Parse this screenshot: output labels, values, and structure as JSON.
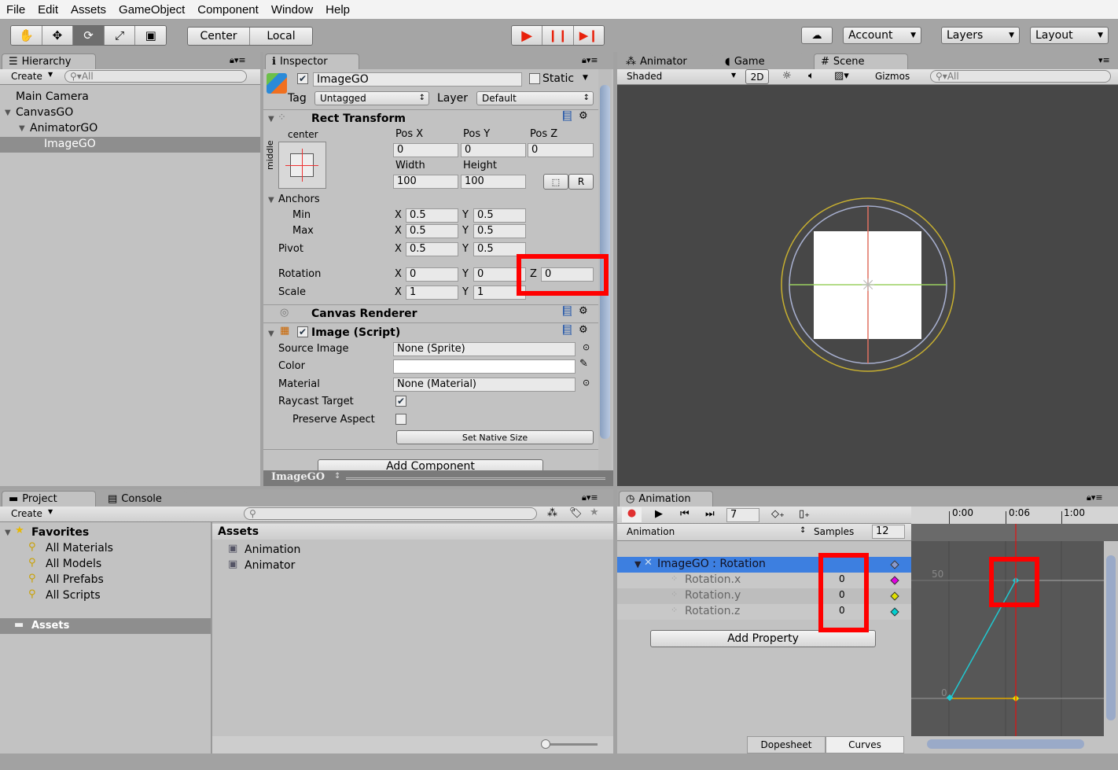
{
  "menu": [
    "File",
    "Edit",
    "Assets",
    "GameObject",
    "Component",
    "Window",
    "Help"
  ],
  "toolbar": {
    "tools": [
      "hand-icon",
      "move-icon",
      "rotate-icon",
      "scale-icon",
      "rect-icon"
    ],
    "pivot": "Center",
    "space": "Local",
    "account": "Account",
    "layers": "Layers",
    "layout": "Layout"
  },
  "hierarchy": {
    "tab": "Hierarchy",
    "create": "Create",
    "search": "All",
    "items": [
      {
        "label": "Main Camera",
        "indent": 0,
        "expanded": null,
        "selected": false
      },
      {
        "label": "CanvasGO",
        "indent": 0,
        "expanded": true,
        "selected": false
      },
      {
        "label": "AnimatorGO",
        "indent": 1,
        "expanded": true,
        "selected": false
      },
      {
        "label": "ImageGO",
        "indent": 2,
        "expanded": null,
        "selected": true
      }
    ]
  },
  "inspector": {
    "tab": "Inspector",
    "name": "ImageGO",
    "static": "Static",
    "tag_label": "Tag",
    "tag": "Untagged",
    "layer_label": "Layer",
    "layer": "Default",
    "rect": {
      "title": "Rect Transform",
      "anchor_h": "center",
      "anchor_v": "middle",
      "posx_l": "Pos X",
      "posy_l": "Pos Y",
      "posz_l": "Pos Z",
      "posx": "0",
      "posy": "0",
      "posz": "0",
      "width_l": "Width",
      "height_l": "Height",
      "width": "100",
      "height": "100",
      "r": "R",
      "anchors": "Anchors",
      "min": "Min",
      "max": "Max",
      "pivot": "Pivot",
      "minx": "0.5",
      "miny": "0.5",
      "maxx": "0.5",
      "maxy": "0.5",
      "pivx": "0.5",
      "pivy": "0.5",
      "rotation": "Rotation",
      "scale": "Scale",
      "rotx": "0",
      "roty": "0",
      "rotz": "0",
      "scx": "1",
      "scy": "1",
      "x": "X",
      "y": "Y",
      "z": "Z"
    },
    "canvas_renderer": "Canvas Renderer",
    "image": {
      "title": "Image (Script)",
      "source_l": "Source Image",
      "source": "None (Sprite)",
      "color_l": "Color",
      "material_l": "Material",
      "material": "None (Material)",
      "raycast_l": "Raycast Target",
      "raycast": true,
      "preserve_l": "Preserve Aspect",
      "preserve": false,
      "native": "Set Native Size"
    },
    "add_component": "Add Component",
    "footer": "ImageGO"
  },
  "scene": {
    "tabs": [
      "Animator",
      "Game",
      "Scene"
    ],
    "active_tab": "Scene",
    "shading": "Shaded",
    "mode2d": "2D",
    "gizmos": "Gizmos",
    "search": "All"
  },
  "project": {
    "tabs": [
      "Project",
      "Console"
    ],
    "create": "Create",
    "favorites": "Favorites",
    "fav_items": [
      "All Materials",
      "All Models",
      "All Prefabs",
      "All Scripts"
    ],
    "assets_root": "Assets",
    "assets_header": "Assets",
    "assets": [
      {
        "label": "Animation",
        "icon": "animation-clip-icon"
      },
      {
        "label": "Animator",
        "icon": "animator-controller-icon"
      }
    ]
  },
  "animation": {
    "tab": "Animation",
    "frame": "7",
    "clip": "Animation",
    "samples_l": "Samples",
    "samples": "12",
    "tracks": [
      {
        "label": "ImageGO : Rotation",
        "value": "",
        "selected": true,
        "color": "#8899cc"
      },
      {
        "label": "Rotation.x",
        "value": "0",
        "color": "#e000e0"
      },
      {
        "label": "Rotation.y",
        "value": "0",
        "color": "#e0e000"
      },
      {
        "label": "Rotation.z",
        "value": "0",
        "color": "#00d0d0"
      }
    ],
    "add_property": "Add Property",
    "times": [
      "0:00",
      "0:06",
      "1:00"
    ],
    "y_labels": [
      "50",
      "0"
    ],
    "view_tabs": [
      "Dopesheet",
      "Curves"
    ],
    "active_view": "Curves",
    "record_color": "#e03030",
    "curve_color": "#20c8d0",
    "playhead_color": "#ff0000"
  },
  "highlight_color": "#ff0000"
}
